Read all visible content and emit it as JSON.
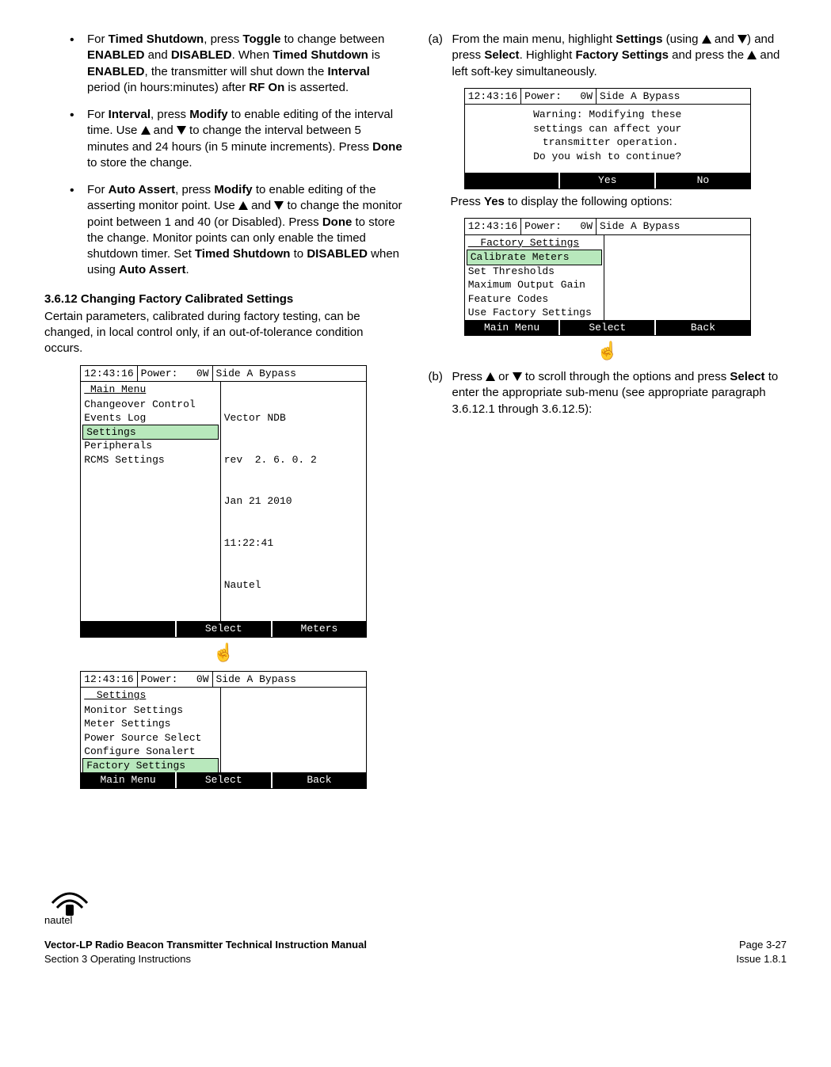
{
  "col1": {
    "bullet1": {
      "pre": "For ",
      "b1": "Timed Shutdown",
      "mid1": ", press ",
      "b2": "Toggle",
      "mid2": " to change between ",
      "b3": "ENABLED",
      "mid3": " and ",
      "b4": "DISABLED",
      "mid4": ". When ",
      "b5": "Timed Shutdown",
      "mid5": " is ",
      "b6": "ENABLED",
      "mid6": ", the transmitter will shut down the ",
      "b7": "Interval",
      "mid7": " period (in hours:minutes) after ",
      "b8": "RF On",
      "mid8": " is asserted."
    },
    "bullet2": {
      "pre": "For ",
      "b1": "Interval",
      "mid1": ", press ",
      "b2": "Modify",
      "mid2": " to enable editing of the interval time. Use ",
      "mid3": " and ",
      "mid4": " to change the interval between 5 minutes and 24 hours (in 5 minute increments). Press ",
      "b3": "Done",
      "mid5": " to store the change."
    },
    "bullet3": {
      "pre": "For ",
      "b1": "Auto Assert",
      "mid1": ", press ",
      "b2": "Modify",
      "mid2": " to enable editing of the asserting monitor point. Use ",
      "mid3": " and ",
      "mid4": " to change the monitor point between 1 and 40 (or Disabled). Press ",
      "b3": "Done",
      "mid5": " to store the change. Monitor points can only enable the timed shutdown timer. Set ",
      "b4": "Timed Shutdown",
      "mid6": " to ",
      "b5": "DISABLED",
      "mid7": " when using ",
      "b6": "Auto Assert",
      "mid8": "."
    },
    "heading": "3.6.12 Changing Factory Calibrated Settings",
    "intro": "Certain parameters, calibrated during factory testing, can be changed, in local control only, if an out-of-tolerance condition occurs.",
    "lcd1": {
      "time": "12:43:16",
      "powerLabel": "Power:",
      "powerVal": "   0W",
      "status": "Side A Bypass",
      "title": " Main Menu",
      "rows": [
        "Changeover Control",
        "Events Log",
        "Settings",
        "Peripherals",
        "RCMS Settings"
      ],
      "selectedIndex": 2,
      "right": [
        "Vector NDB",
        "rev  2. 6. 0. 2",
        "Jan 21 2010",
        "11:22:41",
        "Nautel"
      ],
      "footer": [
        "",
        "Select",
        "Meters"
      ]
    },
    "lcd2": {
      "time": "12:43:16",
      "powerLabel": "Power:",
      "powerVal": "   0W",
      "status": "Side A Bypass",
      "title": "  Settings",
      "rows": [
        "Monitor Settings",
        "Meter Settings",
        "Power Source Select",
        "Configure Sonalert",
        "Factory Settings"
      ],
      "selectedIndex": 4,
      "footer": [
        "Main Menu",
        "Select",
        "Back"
      ]
    }
  },
  "col2": {
    "stepA": {
      "marker": "(a)",
      "t1": "From the main menu, highlight ",
      "b1": "Settings",
      "t2": " (using ",
      "t3": " and ",
      "t4": ") and press ",
      "b2": "Select",
      "t5": ". Highlight ",
      "b3": "Factory Settings",
      "t6": " and press the ",
      "t7": " and left soft-key simultaneously."
    },
    "lcdWarn": {
      "time": "12:43:16",
      "powerLabel": "Power:",
      "powerVal": "   0W",
      "status": "Side A Bypass",
      "warn": [
        "Warning: Modifying these",
        "settings can affect your",
        " transmitter operation.",
        "Do you wish to continue?"
      ],
      "footer": [
        "",
        "Yes",
        "No"
      ]
    },
    "pressYes": {
      "pre": "Press ",
      "b": "Yes",
      "post": " to display the following options:"
    },
    "lcdFactory": {
      "time": "12:43:16",
      "powerLabel": "Power:",
      "powerVal": "   0W",
      "status": "Side A Bypass",
      "title": "  Factory Settings",
      "rows": [
        "Calibrate Meters",
        "Set Thresholds",
        "Maximum Output Gain",
        "Feature Codes",
        "Use Factory Settings"
      ],
      "selectedIndex": 0,
      "footer": [
        "Main Menu",
        "Select",
        "Back"
      ]
    },
    "stepB": {
      "marker": "(b)",
      "t1": "Press ",
      "t2": " or ",
      "t3": " to scroll through the options and press ",
      "b1": "Select",
      "t4": " to enter the appropriate sub-menu (see appropriate paragraph 3.6.12.1 through 3.6.12.5):"
    }
  },
  "footer": {
    "logoText": "nautel",
    "leftTitle": "Vector-LP Radio Beacon Transmitter Technical Instruction Manual",
    "leftSub": "Section 3 Operating Instructions",
    "rightPage": "Page 3-27",
    "rightIssue": "Issue 1.8.1"
  }
}
